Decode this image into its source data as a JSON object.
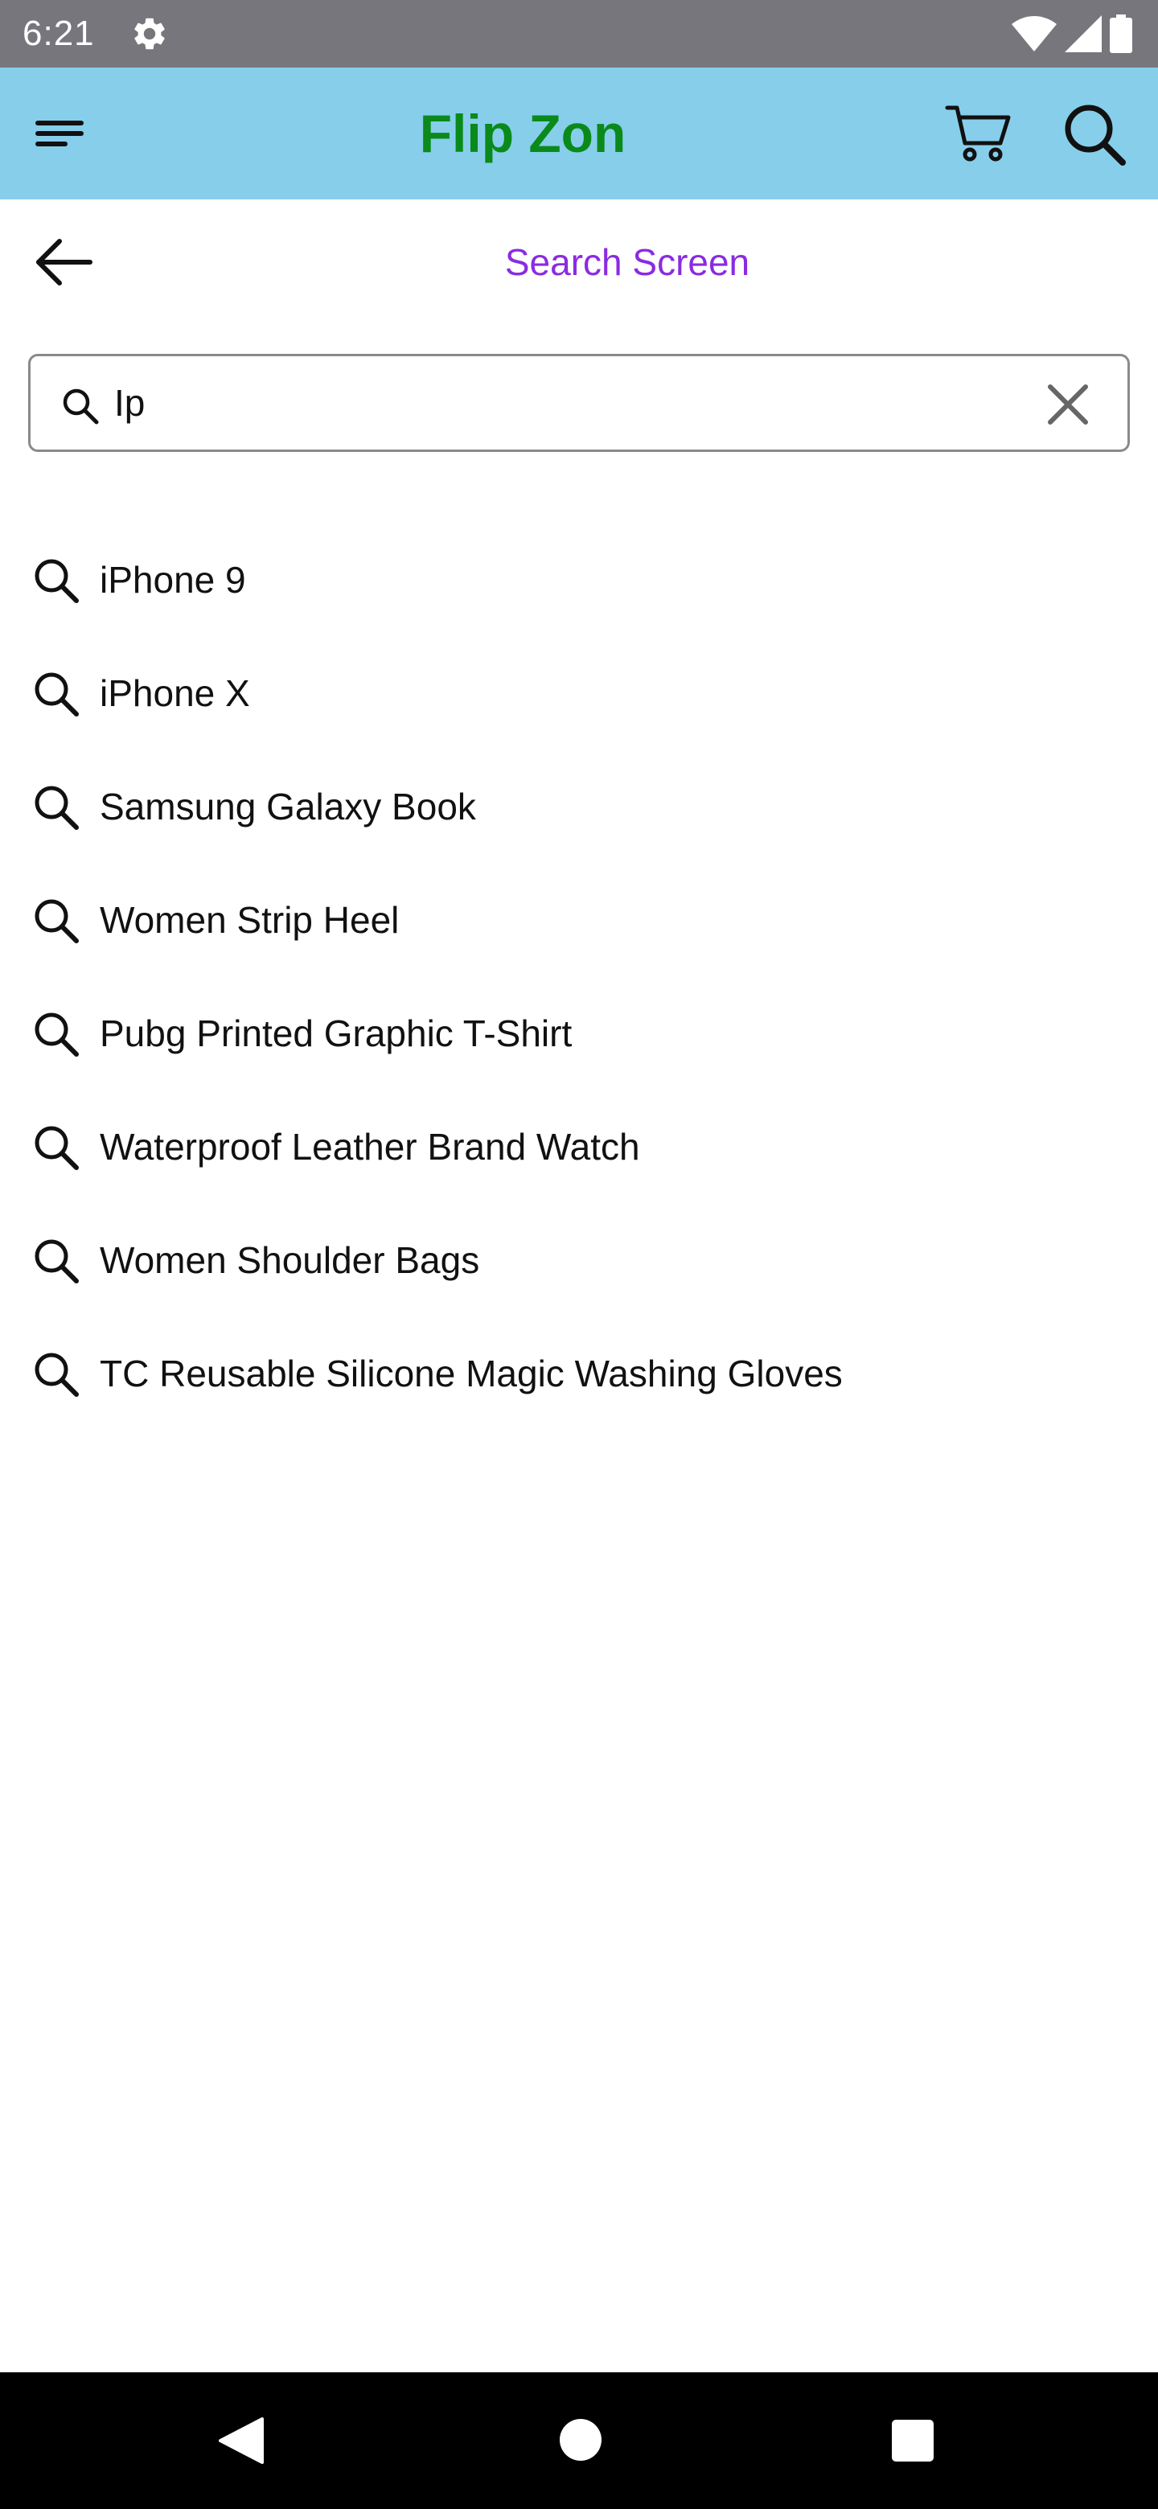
{
  "status_bar": {
    "time": "6:21",
    "icons": [
      "settings-gear-icon",
      "wifi-icon",
      "cellular-signal-icon",
      "battery-icon"
    ]
  },
  "app_bar": {
    "title": "Flip Zon",
    "title_color": "#0a8a1a",
    "background": "#87ceeb",
    "icons": [
      "menu-icon",
      "cart-icon",
      "search-icon"
    ]
  },
  "header": {
    "title": "Search Screen",
    "title_color": "#8a2be2",
    "back_icon": "arrow-left-icon"
  },
  "search": {
    "value": "Ip",
    "icons": [
      "search-icon",
      "clear-icon"
    ]
  },
  "suggestions": [
    {
      "label": "iPhone 9"
    },
    {
      "label": "iPhone X"
    },
    {
      "label": "Samsung Galaxy Book"
    },
    {
      "label": "Women Strip Heel"
    },
    {
      "label": "Pubg Printed Graphic T-Shirt"
    },
    {
      "label": "Waterproof Leather Brand Watch"
    },
    {
      "label": "Women Shoulder Bags"
    },
    {
      "label": "TC Reusable Silicone Magic Washing Gloves"
    }
  ],
  "nav_bar": {
    "icons": [
      "back-triangle-icon",
      "home-circle-icon",
      "recents-square-icon"
    ]
  }
}
